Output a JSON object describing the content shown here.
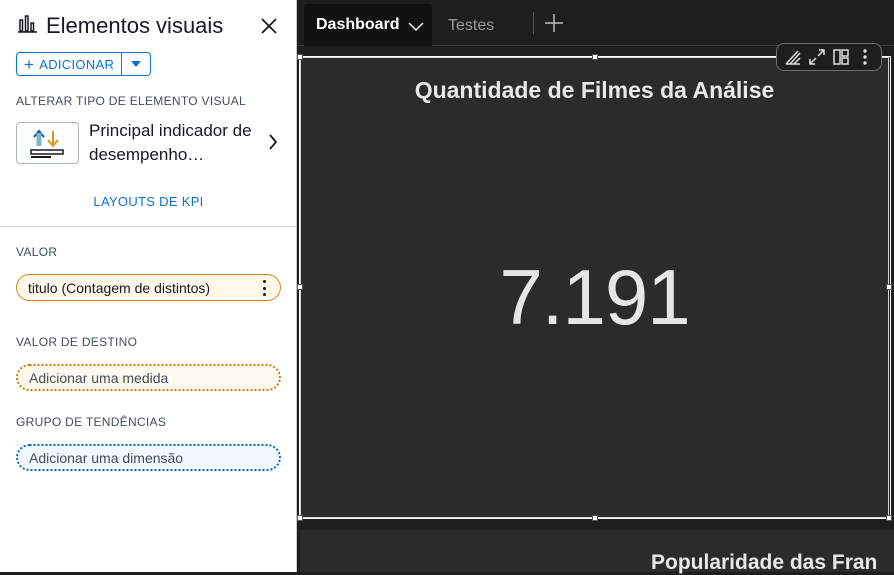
{
  "panel": {
    "title": "Elementos visuais",
    "add_button": "ADICIONAR",
    "change_type_label": "ALTERAR TIPO DE ELEMENTO VISUAL",
    "current_type": "Principal indicador de desempenho…",
    "kpi_layouts_link": "LAYOUTS DE KPI",
    "value_label": "VALOR",
    "value_field": "titulo (Contagem de distintos)",
    "target_label": "VALOR DE DESTINO",
    "target_placeholder": "Adicionar uma medida",
    "trend_label": "GRUPO DE TENDÊNCIAS",
    "trend_placeholder": "Adicionar uma dimensão"
  },
  "tabs": [
    {
      "label": "Dashboard",
      "active": true
    },
    {
      "label": "Testes",
      "active": false
    }
  ],
  "visual": {
    "title": "Quantidade de Filmes da Análise",
    "kpi_value": "7.191"
  },
  "next_visual": {
    "title": "Popularidade das Fran"
  },
  "colors": {
    "accent": "#0972d3",
    "value_well": "#d18a1a",
    "trend_well": "#0a6fb1",
    "canvas_bg": "#1e1e1e",
    "card_bg": "#2b2b2b"
  }
}
